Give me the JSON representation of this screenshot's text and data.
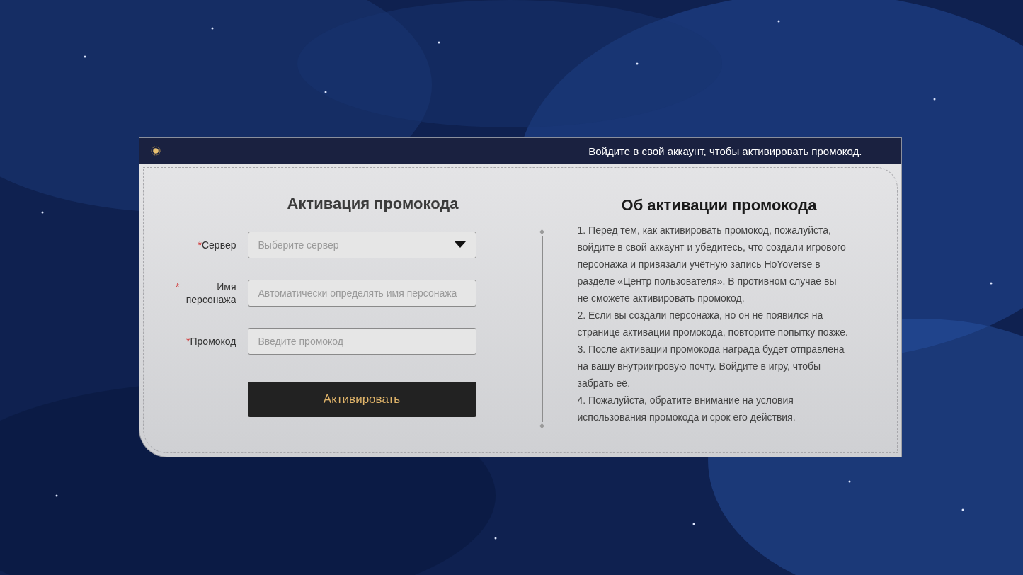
{
  "banner": {
    "text": "Войдите в свой аккаунт, чтобы активировать промокод."
  },
  "form": {
    "title": "Активация промокода",
    "fields": [
      {
        "kind": "select",
        "required": true,
        "label": "Сервер",
        "placeholder": "Выберите сервер"
      },
      {
        "kind": "auto",
        "required": true,
        "label": "Имя персонажа",
        "placeholder": "Автоматически определять имя персонажа"
      },
      {
        "kind": "text",
        "required": true,
        "label": "Промокод",
        "placeholder": "Введите промокод"
      }
    ],
    "required_mark": "*",
    "submit": "Активировать"
  },
  "about": {
    "title": "Об активации промокода",
    "paragraphs": [
      "1. Перед тем, как активировать промокод, пожалуйста, войдите в свой аккаунт и убедитесь, что создали игрового персонажа и привязали учётную запись HoYoverse в разделе «Центр пользователя». В противном случае вы не сможете активировать промокод.",
      "2. Если вы создали персонажа, но он не появился на странице активации промокода, повторите попытку позже.",
      "3. После активации промокода награда будет отправлена на вашу внутриигровую почту. Войдите в игру, чтобы забрать её.",
      "4. Пожалуйста, обратите внимание на условия использования промокода и срок его действия."
    ]
  }
}
